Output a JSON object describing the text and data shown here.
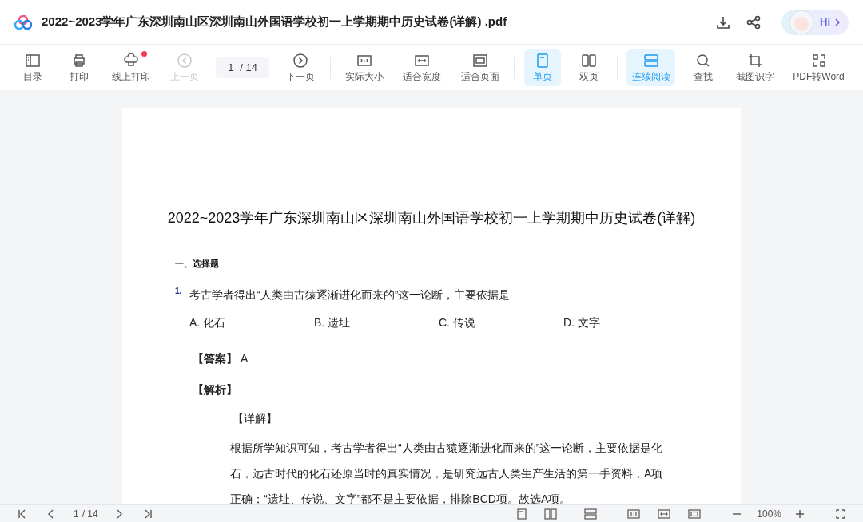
{
  "window": {
    "title": "2022~2023学年广东深圳南山区深圳南山外国语学校初一上学期期中历史试卷(详解) .pdf",
    "assistant_label": "Hi"
  },
  "toolbar": [
    {
      "kind": "button",
      "label": "目录",
      "disabled": false,
      "selected": false,
      "notification": false
    },
    {
      "kind": "button",
      "label": "打印",
      "disabled": false,
      "selected": false,
      "notification": false
    },
    {
      "kind": "button",
      "label": "线上打印",
      "disabled": false,
      "selected": false,
      "notification": true
    },
    {
      "kind": "button",
      "label": "上一页",
      "disabled": true,
      "selected": false,
      "notification": false
    },
    {
      "kind": "pager",
      "page": "1",
      "total": "/ 14"
    },
    {
      "kind": "button",
      "label": "下一页",
      "disabled": false,
      "selected": false,
      "notification": false
    },
    {
      "kind": "separator"
    },
    {
      "kind": "button",
      "label": "实际大小",
      "disabled": false,
      "selected": false,
      "notification": false
    },
    {
      "kind": "button",
      "label": "适合宽度",
      "disabled": false,
      "selected": false,
      "notification": false
    },
    {
      "kind": "button",
      "label": "适合页面",
      "disabled": false,
      "selected": false,
      "notification": false
    },
    {
      "kind": "separator"
    },
    {
      "kind": "button",
      "label": "单页",
      "disabled": false,
      "selected": true,
      "notification": false
    },
    {
      "kind": "button",
      "label": "双页",
      "disabled": false,
      "selected": false,
      "notification": false
    },
    {
      "kind": "separator"
    },
    {
      "kind": "button",
      "label": "连续阅读",
      "disabled": false,
      "selected": true,
      "notification": false
    },
    {
      "kind": "button",
      "label": "查找",
      "disabled": false,
      "selected": false,
      "notification": false
    },
    {
      "kind": "button",
      "label": "截图识字",
      "disabled": false,
      "selected": false,
      "notification": false
    },
    {
      "kind": "button",
      "label": "PDF转Word",
      "disabled": false,
      "selected": false,
      "notification": false
    }
  ],
  "document": {
    "title": "2022~2023学年广东深圳南山区深圳南山外国语学校初一上学期期中历史试卷(详解)",
    "section": "一、选择题",
    "question": {
      "number": "1.",
      "text": "考古学者得出“人类由古猿逐渐进化而来的”这一论断，主要依据是",
      "options": [
        "A. 化石",
        "B. 遗址",
        "C. 传说",
        "D. 文字"
      ],
      "answer_label": "【答案】",
      "answer": "A",
      "analysis_label": "【解析】",
      "detail_label": "【详解】",
      "explanation": "根据所学知识可知，考古学者得出“人类由古猿逐渐进化而来的”这一论断，主要依据是化石，远古时代的化石还原当时的真实情况，是研究远古人类生产生活的第一手资料，A项正确；“遗址、传说、文字”都不是主要依据，排除BCD项。故选A项。"
    }
  },
  "status_bar": {
    "page": "1",
    "total": "/ 14",
    "zoom": "100%"
  }
}
